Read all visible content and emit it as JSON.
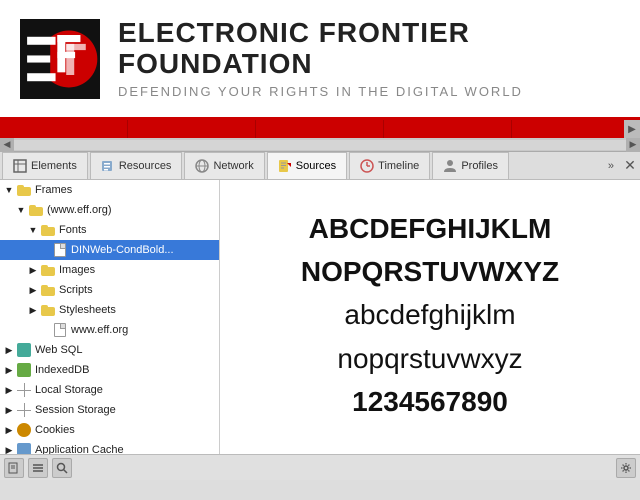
{
  "banner": {
    "title": "ELECTRONIC FRONTIER FOUNDATION",
    "subtitle": "DEFENDING YOUR RIGHTS IN THE DIGITAL WORLD"
  },
  "tabs": [
    {
      "id": "elements",
      "label": "Elements",
      "icon": "elements-icon"
    },
    {
      "id": "resources",
      "label": "Resources",
      "icon": "resources-icon"
    },
    {
      "id": "network",
      "label": "Network",
      "icon": "network-icon"
    },
    {
      "id": "sources",
      "label": "Sources",
      "icon": "sources-icon"
    },
    {
      "id": "timeline",
      "label": "Timeline",
      "icon": "timeline-icon"
    },
    {
      "id": "profiles",
      "label": "Profiles",
      "icon": "profiles-icon"
    }
  ],
  "sidebar": {
    "frames_label": "Frames",
    "www_eff_label": "(www.eff.org)",
    "fonts_label": "Fonts",
    "font_file_label": "DINWeb-CondBold...",
    "images_label": "Images",
    "scripts_label": "Scripts",
    "stylesheets_label": "Stylesheets",
    "www_eff_file_label": "www.eff.org",
    "websql_label": "Web SQL",
    "indexeddb_label": "IndexedDB",
    "localstorage_label": "Local Storage",
    "sessionstorage_label": "Session Storage",
    "cookies_label": "Cookies",
    "appcache_label": "Application Cache"
  },
  "font_preview": {
    "lines": [
      "ABCDEFGHIJKLM",
      "NOPQRSTUVWXYZ",
      "abcdefghijklm",
      "nopqrstuvwxyz",
      "1234567890"
    ]
  },
  "bottom_toolbar": {
    "new_btn": "📄",
    "list_btn": "≡",
    "search_btn": "🔍",
    "settings_btn": "⚙"
  }
}
